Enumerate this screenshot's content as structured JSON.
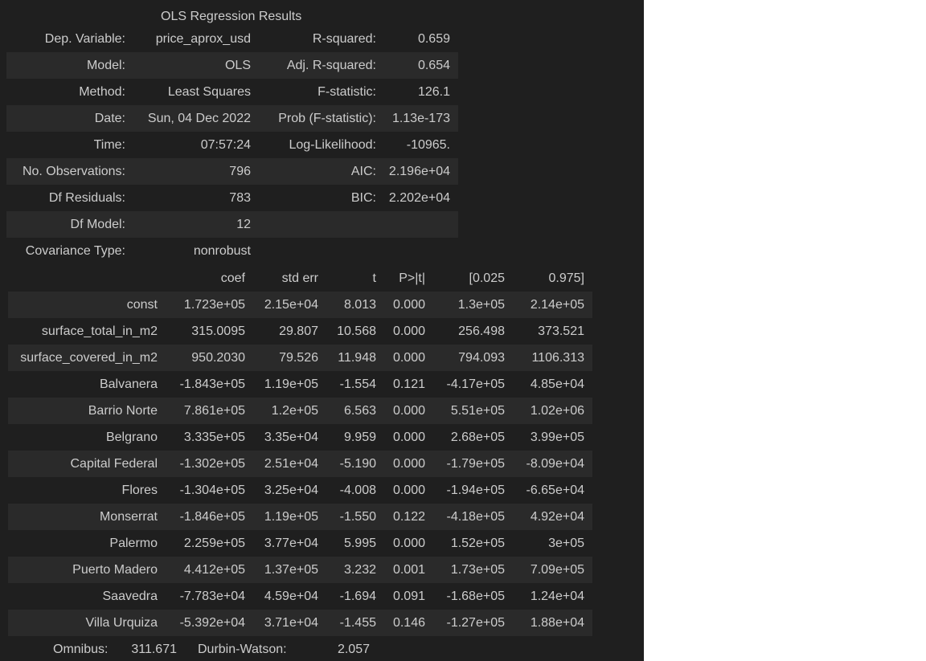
{
  "title": "OLS Regression Results",
  "summary_rows": [
    [
      "Dep. Variable:",
      "price_aprox_usd",
      "R-squared:",
      "0.659"
    ],
    [
      "Model:",
      "OLS",
      "Adj. R-squared:",
      "0.654"
    ],
    [
      "Method:",
      "Least Squares",
      "F-statistic:",
      "126.1"
    ],
    [
      "Date:",
      "Sun, 04 Dec 2022",
      "Prob (F-statistic):",
      "1.13e-173"
    ],
    [
      "Time:",
      "07:57:24",
      "Log-Likelihood:",
      "-10965."
    ],
    [
      "No. Observations:",
      "796",
      "AIC:",
      "2.196e+04"
    ],
    [
      "Df Residuals:",
      "783",
      "BIC:",
      "2.202e+04"
    ],
    [
      "Df Model:",
      "12",
      "",
      ""
    ],
    [
      "Covariance Type:",
      "nonrobust",
      "",
      ""
    ]
  ],
  "coef_headers": [
    "",
    "coef",
    "std err",
    "t",
    "P>|t|",
    "[0.025",
    "0.975]"
  ],
  "coef_rows": [
    [
      "const",
      "1.723e+05",
      "2.15e+04",
      "8.013",
      "0.000",
      "1.3e+05",
      "2.14e+05"
    ],
    [
      "surface_total_in_m2",
      "315.0095",
      "29.807",
      "10.568",
      "0.000",
      "256.498",
      "373.521"
    ],
    [
      "surface_covered_in_m2",
      "950.2030",
      "79.526",
      "11.948",
      "0.000",
      "794.093",
      "1106.313"
    ],
    [
      "Balvanera",
      "-1.843e+05",
      "1.19e+05",
      "-1.554",
      "0.121",
      "-4.17e+05",
      "4.85e+04"
    ],
    [
      "Barrio Norte",
      "7.861e+05",
      "1.2e+05",
      "6.563",
      "0.000",
      "5.51e+05",
      "1.02e+06"
    ],
    [
      "Belgrano",
      "3.335e+05",
      "3.35e+04",
      "9.959",
      "0.000",
      "2.68e+05",
      "3.99e+05"
    ],
    [
      "Capital Federal",
      "-1.302e+05",
      "2.51e+04",
      "-5.190",
      "0.000",
      "-1.79e+05",
      "-8.09e+04"
    ],
    [
      "Flores",
      "-1.304e+05",
      "3.25e+04",
      "-4.008",
      "0.000",
      "-1.94e+05",
      "-6.65e+04"
    ],
    [
      "Monserrat",
      "-1.846e+05",
      "1.19e+05",
      "-1.550",
      "0.122",
      "-4.18e+05",
      "4.92e+04"
    ],
    [
      "Palermo",
      "2.259e+05",
      "3.77e+04",
      "5.995",
      "0.000",
      "1.52e+05",
      "3e+05"
    ],
    [
      "Puerto Madero",
      "4.412e+05",
      "1.37e+05",
      "3.232",
      "0.001",
      "1.73e+05",
      "7.09e+05"
    ],
    [
      "Saavedra",
      "-7.783e+04",
      "4.59e+04",
      "-1.694",
      "0.091",
      "-1.68e+05",
      "1.24e+04"
    ],
    [
      "Villa Urquiza",
      "-5.392e+04",
      "3.71e+04",
      "-1.455",
      "0.146",
      "-1.27e+05",
      "1.88e+04"
    ]
  ],
  "diagnostics": {
    "omnibus_label": "Omnibus:",
    "omnibus_value": "311.671",
    "dw_label": "Durbin-Watson:",
    "dw_value": "2.057"
  }
}
